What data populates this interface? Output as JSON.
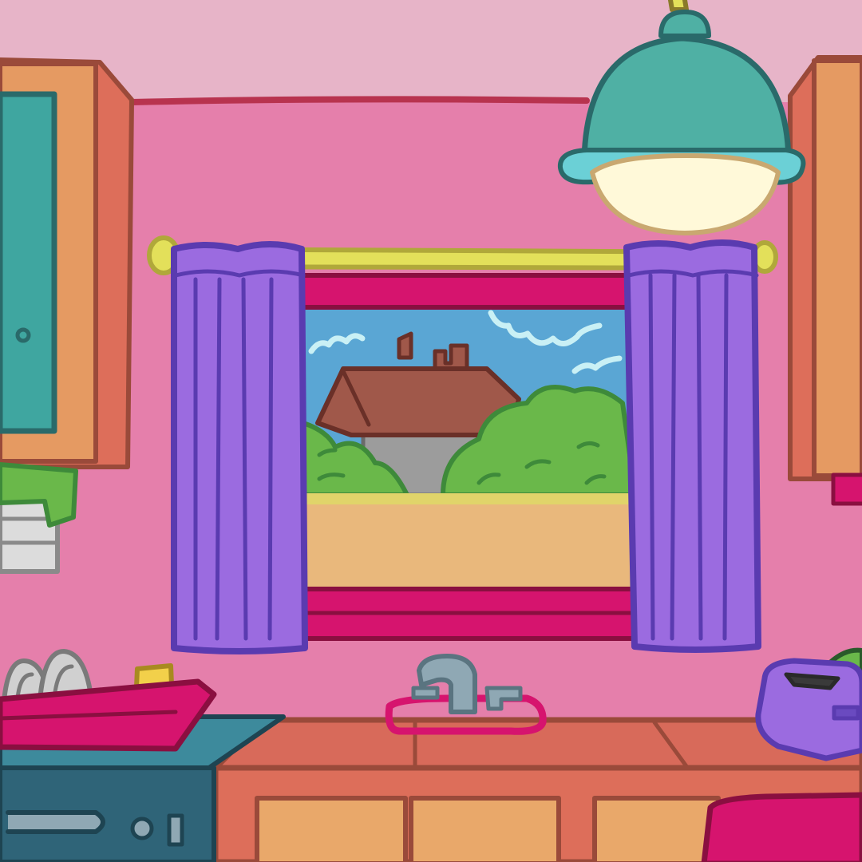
{
  "scene": {
    "description_free": true
  },
  "palette": {
    "ceiling": "#e7b4c8",
    "wall": "#e57fab",
    "wall_line": "#b8334f",
    "cabinet_wood": "#e59a62",
    "cabinet_side": "#dd6e5a",
    "cabinet_edge": "#9a4a3a",
    "cabinet_door": "#3fa6a0",
    "cabinet_door_edge": "#2a6a6a",
    "curtain": "#9b6be0",
    "curtain_edge": "#5a3bb0",
    "curtain_rod": "#e3e05a",
    "window_frame": "#d6146e",
    "window_frame_dark": "#8a0f40",
    "sky": "#5aa6d4",
    "cloud": "#c9f0f5",
    "roof": "#a0584a",
    "house_wall": "#9c9c9c",
    "bushes": "#6ab84a",
    "bush_edge": "#3e8a3a",
    "lawn_strip": "#e0d46a",
    "sill": "#e9b87c",
    "lamp": "#4fb0a4",
    "lamp_rim": "#6bd0d6",
    "lamp_glow": "#fff9d9",
    "counter_top": "#d86a5a",
    "counter_cabinet": "#e9a86a",
    "stove": "#2f6478",
    "stove_top": "#3d8a9c",
    "sink_rim": "#d6146e",
    "faucet": "#8fa8b4",
    "dish_rack": "#d6146e",
    "plates": "#d0d0d0",
    "cup": "#f2d04a",
    "toaster": "#9b6be0",
    "towel": "#d6146e",
    "paper_holder": "#6ab84a",
    "paper_roll": "#dcdcdc"
  }
}
